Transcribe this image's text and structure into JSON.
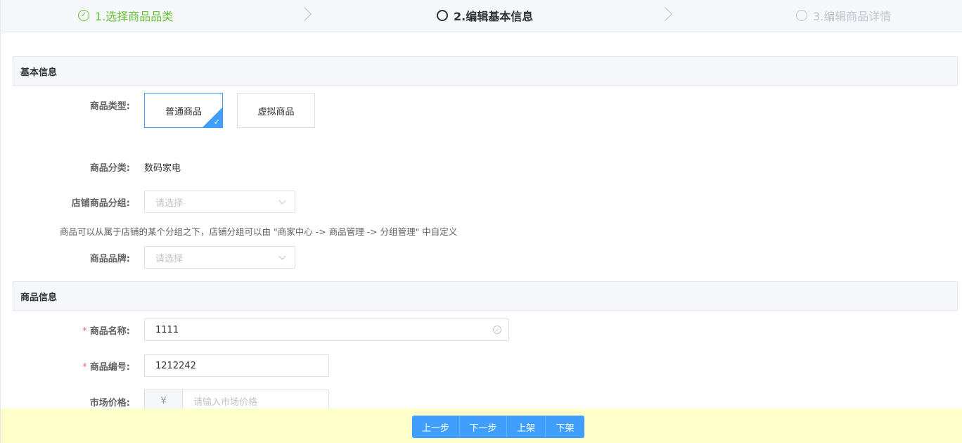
{
  "steps": [
    {
      "label": "1.选择商品品类",
      "state": "done",
      "icon": "check-circle-icon"
    },
    {
      "label": "2.编辑基本信息",
      "state": "active",
      "icon": "circle-icon"
    },
    {
      "label": "3.编辑商品详情",
      "state": "pending",
      "icon": "circle-icon"
    }
  ],
  "basic_section": {
    "title": "基本信息",
    "product_type": {
      "label": "商品类型:",
      "options": [
        "普通商品",
        "虚拟商品"
      ],
      "selected": "普通商品"
    },
    "category": {
      "label": "商品分类:",
      "value": "数码家电"
    },
    "shop_group": {
      "label": "店铺商品分组:",
      "placeholder": "请选择"
    },
    "hint": "商品可以从属于店铺的某个分组之下，店铺分组可以由 \"商家中心 -> 商品管理 -> 分组管理\" 中自定义",
    "brand": {
      "label": "商品品牌:",
      "placeholder": "请选择"
    }
  },
  "product_section": {
    "title": "商品信息",
    "name": {
      "label": "商品名称:",
      "value": "1111",
      "required": true
    },
    "code": {
      "label": "商品编号:",
      "value": "1212242",
      "required": true
    },
    "market_price": {
      "label": "市场价格:",
      "prefix": "¥",
      "placeholder": "请输入市场价格"
    }
  },
  "footer": {
    "buttons": [
      "上一步",
      "下一步",
      "上架",
      "下架"
    ]
  },
  "colors": {
    "primary": "#409eff",
    "success": "#67c23a",
    "danger": "#f56c6c",
    "footer_bg": "#ffffcc"
  }
}
